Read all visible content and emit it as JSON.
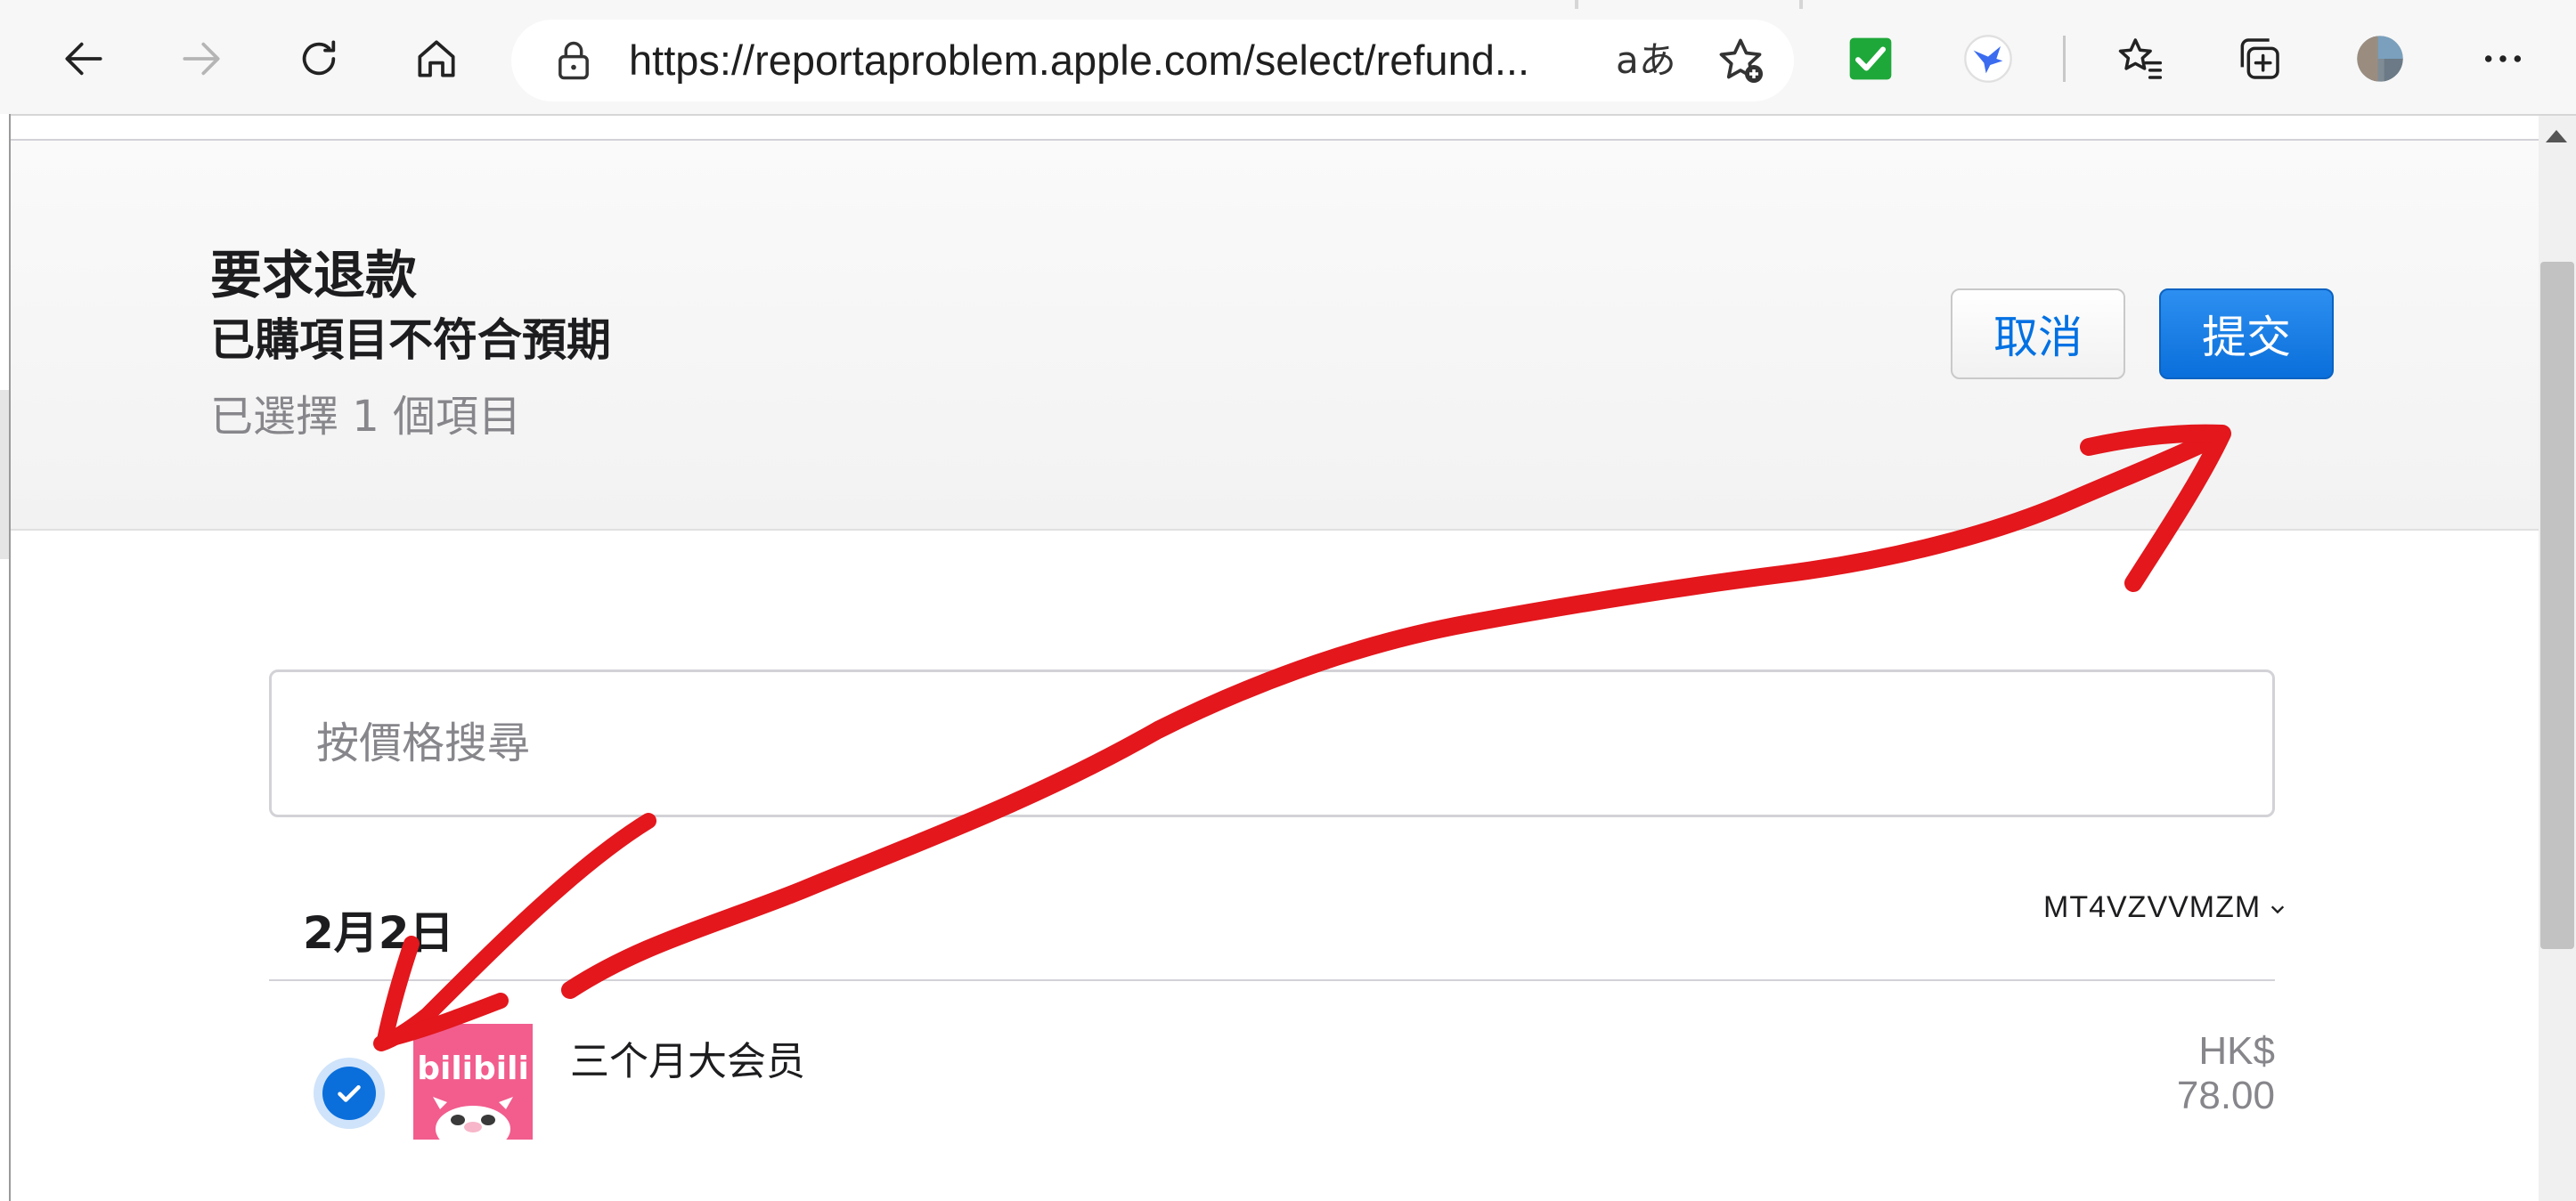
{
  "browser": {
    "url": "https://reportaproblem.apple.com/select/refund...",
    "read_aloud_glyph": "aあ",
    "icons": [
      "back-icon",
      "forward-icon",
      "refresh-icon",
      "home-icon",
      "lock-icon",
      "add-favorite-icon",
      "extension-check-icon",
      "extension-bird-icon",
      "favorites-icon",
      "collections-icon",
      "profile-avatar",
      "more-icon"
    ],
    "colors": {
      "toolbar": "#f7f7f7",
      "extension_green": "#1fa83a"
    }
  },
  "header": {
    "title": "要求退款",
    "subtitle": "已購項目不符合預期",
    "selected_count": "已選擇 1 個項目",
    "cancel_label": "取消",
    "submit_label": "提交"
  },
  "search": {
    "placeholder": "按價格搜尋"
  },
  "group": {
    "date": "2月2日",
    "order_id": "MT4VZVVMZM"
  },
  "item": {
    "name": "三个月大会员",
    "price": "HK$ 78.00",
    "selected": true,
    "app_logo_text": "bilibili"
  },
  "colors": {
    "accent": "#0071e3",
    "annotation": "#e3171c",
    "app_icon_bg": "#f25d8e"
  }
}
